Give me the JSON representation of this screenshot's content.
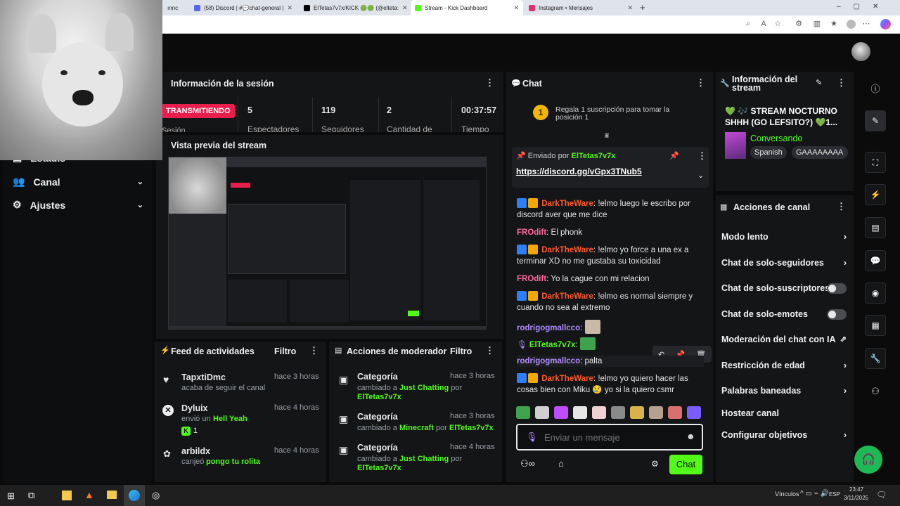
{
  "browser": {
    "tabs": [
      {
        "label": "ınnc",
        "color": "#888888"
      },
      {
        "label": "(58) Discord | #💬chat-general |",
        "color": "#5865f2"
      },
      {
        "label": "ElTetas7v7x/KICK 🟢🟢 (@elteta:",
        "color": "#000000"
      },
      {
        "label": "Stream - Kick Dashboard",
        "color": "#53fc18"
      },
      {
        "label": "Instagram • Mensajes",
        "color": "#e1306c"
      }
    ],
    "new_tab": "+"
  },
  "sidebar": {
    "items": [
      {
        "label": "Estadís"
      },
      {
        "label": "Canal"
      },
      {
        "label": "Ajustes"
      }
    ]
  },
  "session": {
    "title": "Información de la sesión",
    "status": "TRANSMITIENDO",
    "stats": [
      {
        "value": "5",
        "label": "Espectadores"
      },
      {
        "value": "119",
        "label": "Seguidores"
      },
      {
        "value": "2",
        "label": "Cantidad de"
      },
      {
        "value": "00:37:57",
        "label": "Tiempo"
      }
    ],
    "session_label": "Sesión"
  },
  "preview": {
    "title": "Vista previa del stream"
  },
  "activity": {
    "title": "Feed de actividades",
    "filter": "Filtro",
    "items": [
      {
        "name": "TapxtiDmc",
        "time": "hace 3 horas",
        "text": "acaba de seguir el canal",
        "highlight": "",
        "extra": ""
      },
      {
        "name": "Dyluix",
        "time": "hace 4 horas",
        "text": "envió un",
        "highlight": "Hell Yeah",
        "extra": "1"
      },
      {
        "name": "arbildx",
        "time": "hace 4 horas",
        "text": "canjeó",
        "highlight": "pongo tu rolita",
        "extra": ""
      }
    ]
  },
  "modactions": {
    "title": "Acciones de moderador",
    "filter": "Filtro",
    "items": [
      {
        "title": "Categoría",
        "time": "hace 3 horas",
        "pre": "cambiado a",
        "cat": "Just Chatting",
        "by": "por",
        "user": "ElTetas7v7x"
      },
      {
        "title": "Categoría",
        "time": "hace 3 horas",
        "pre": "cambiado a",
        "cat": "Minecraft",
        "by": "por",
        "user": "ElTetas7v7x"
      },
      {
        "title": "Categoría",
        "time": "hace 4 horas",
        "pre": "cambiado a",
        "cat": "Just Chatting",
        "by": "por",
        "user": "ElTetas7v7x"
      }
    ]
  },
  "chat": {
    "title": "Chat",
    "gift_text": "Regala 1 suscripción para tomar la posición 1",
    "gift_rank": "1",
    "pinned_by_label": "Enviado por",
    "pinned_user": "ElTetas7v7x",
    "pinned_link": "https://discord.gg/vGpx3TNub5",
    "messages": [
      {
        "user": "DarkTheWare",
        "color": "#ff5a2c",
        "badges": true,
        "text": "!elmo luego le escribo por discord aver que me dice"
      },
      {
        "user": "FROdift",
        "color": "#ff6a9a",
        "badges": false,
        "text": "El phonk"
      },
      {
        "user": "DarkTheWare",
        "color": "#ff5a2c",
        "badges": true,
        "text": "!elmo yo force a una ex a terminar XD no me gustaba su toxicidad"
      },
      {
        "user": "FROdift",
        "color": "#ff6a9a",
        "badges": false,
        "text": "Yo la cague con mi relacion"
      },
      {
        "user": "DarkTheWare",
        "color": "#ff5a2c",
        "badges": true,
        "text": "!elmo es normal siempre y cuando no sea al extremo"
      },
      {
        "user": "rodrigogmallcco",
        "color": "#b38cff",
        "badges": false,
        "text": ""
      },
      {
        "user": "ElTetas7v7x",
        "color": "#53fc18",
        "badges": false,
        "text": ""
      },
      {
        "user": "rodrigogmallcco",
        "color": "#b38cff",
        "badges": false,
        "text": "palta"
      },
      {
        "user": "DarkTheWare",
        "color": "#ff5a2c",
        "badges": true,
        "text": "!elmo yo quiero hacer las cosas bien con Miku 😢 yo si la quiero csmr"
      }
    ],
    "input_placeholder": "Enviar un mensaje",
    "send_label": "Chat"
  },
  "stream_info": {
    "title": "Información del stream",
    "stream_title": "💚 🎶 STREAM NOCTURNO SHHH (GO LEFSITO?) 💚1...",
    "category": "Conversando",
    "tags": [
      "Spanish",
      "GAAAAAAAA"
    ]
  },
  "channel_actions": {
    "title": "Acciones de canal",
    "items": [
      {
        "label": "Modo lento",
        "ctl": "chevron"
      },
      {
        "label": "Chat de solo-seguidores",
        "ctl": "chevron"
      },
      {
        "label": "Chat de solo-suscriptores",
        "ctl": "toggle"
      },
      {
        "label": "Chat de solo-emotes",
        "ctl": "toggle"
      },
      {
        "label": "Moderación del chat con IA",
        "ctl": "external"
      },
      {
        "label": "Restricción de edad",
        "ctl": "chevron"
      },
      {
        "label": "Palabras baneadas",
        "ctl": "chevron"
      },
      {
        "label": "Hostear canal",
        "ctl": "none"
      },
      {
        "label": "Configurar objetivos",
        "ctl": "chevron"
      }
    ]
  },
  "taskbar": {
    "tray_label": "Vínculos",
    "lang": "ESP",
    "time": "23:47",
    "date": "3/11/2025"
  },
  "colors": {
    "accent": "#53fc18",
    "live": "#e91e4c",
    "panel": "#141517"
  }
}
